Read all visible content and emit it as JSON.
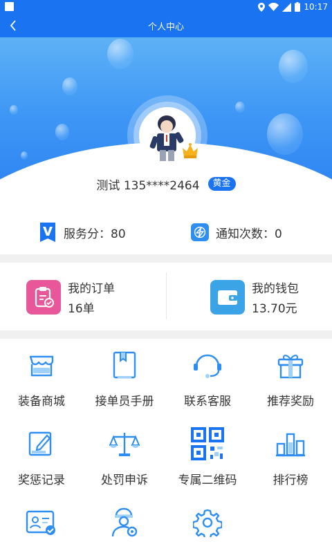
{
  "status_bar": {
    "time": "10:17"
  },
  "nav": {
    "title": "个人中心"
  },
  "user": {
    "name": "测试 135****2464",
    "level": "黄金"
  },
  "stats": [
    {
      "label": "服务分：80",
      "icon": "v-badge-icon"
    },
    {
      "label": "通知次数：0",
      "icon": "notify-icon"
    }
  ],
  "cards": {
    "orders": {
      "title": "我的订单",
      "value": "16单"
    },
    "wallet": {
      "title": "我的钱包",
      "value": "13.70元"
    }
  },
  "menu": [
    {
      "label": "装备商城",
      "icon": "equipment-store-icon"
    },
    {
      "label": "接单员手册",
      "icon": "manual-icon"
    },
    {
      "label": "联系客服",
      "icon": "customer-service-icon"
    },
    {
      "label": "推荐奖励",
      "icon": "gift-icon"
    },
    {
      "label": "奖惩记录",
      "icon": "edit-record-icon"
    },
    {
      "label": "处罚申诉",
      "icon": "scales-icon"
    },
    {
      "label": "专属二维码",
      "icon": "qrcode-icon"
    },
    {
      "label": "排行榜",
      "icon": "ranking-icon"
    },
    {
      "label": "",
      "icon": "id-card-icon"
    },
    {
      "label": "",
      "icon": "worker-settings-icon"
    },
    {
      "label": "",
      "icon": "settings-gear-icon"
    }
  ],
  "colors": {
    "primary": "#1a73f0",
    "accent_blue": "#2f8ef2",
    "orders_pink": "#e8579a",
    "wallet_blue": "#3aa4e6"
  }
}
